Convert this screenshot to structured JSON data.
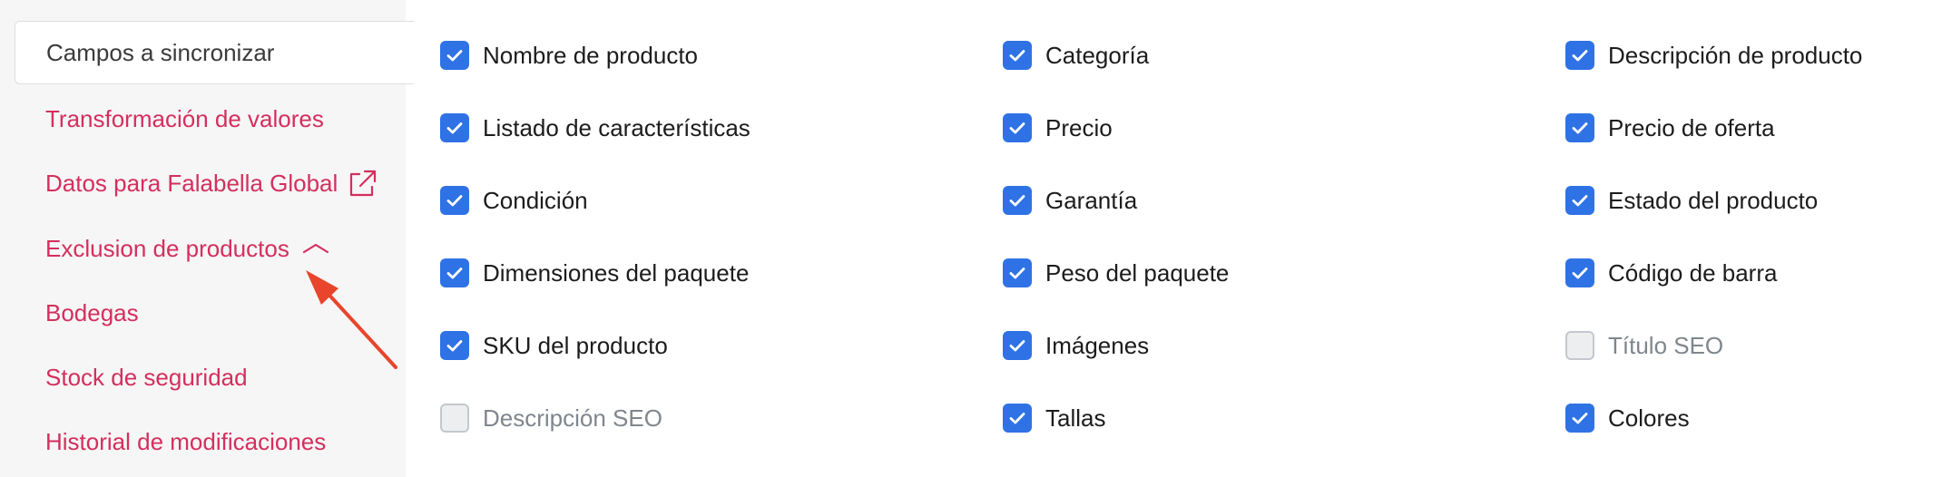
{
  "sidebar": {
    "active": "Campos a sincronizar",
    "items": [
      {
        "label": "Transformación de valores"
      },
      {
        "label": "Datos para Falabella Global",
        "icon": "external-link-icon"
      },
      {
        "label": "Exclusion de productos",
        "icon": "chevron-up-icon"
      },
      {
        "label": "Bodegas"
      },
      {
        "label": "Stock de seguridad"
      },
      {
        "label": "Historial de modificaciones"
      }
    ]
  },
  "fields": [
    {
      "label": "Nombre de producto",
      "checked": true
    },
    {
      "label": "Categoría",
      "checked": true
    },
    {
      "label": "Descripción de producto",
      "checked": true
    },
    {
      "label": "Listado de características",
      "checked": true
    },
    {
      "label": "Precio",
      "checked": true
    },
    {
      "label": "Precio de oferta",
      "checked": true
    },
    {
      "label": "Condición",
      "checked": true
    },
    {
      "label": "Garantía",
      "checked": true
    },
    {
      "label": "Estado del producto",
      "checked": true
    },
    {
      "label": "Dimensiones del paquete",
      "checked": true
    },
    {
      "label": "Peso del paquete",
      "checked": true
    },
    {
      "label": "Código de barra",
      "checked": true
    },
    {
      "label": "SKU del producto",
      "checked": true
    },
    {
      "label": "Imágenes",
      "checked": true
    },
    {
      "label": "Título SEO",
      "checked": false
    },
    {
      "label": "Descripción SEO",
      "checked": false
    },
    {
      "label": "Tallas",
      "checked": true
    },
    {
      "label": "Colores",
      "checked": true
    }
  ],
  "colors": {
    "accent_link": "#d42f5e",
    "checkbox_checked": "#2f72e6",
    "annotation_arrow": "#e8452c"
  }
}
